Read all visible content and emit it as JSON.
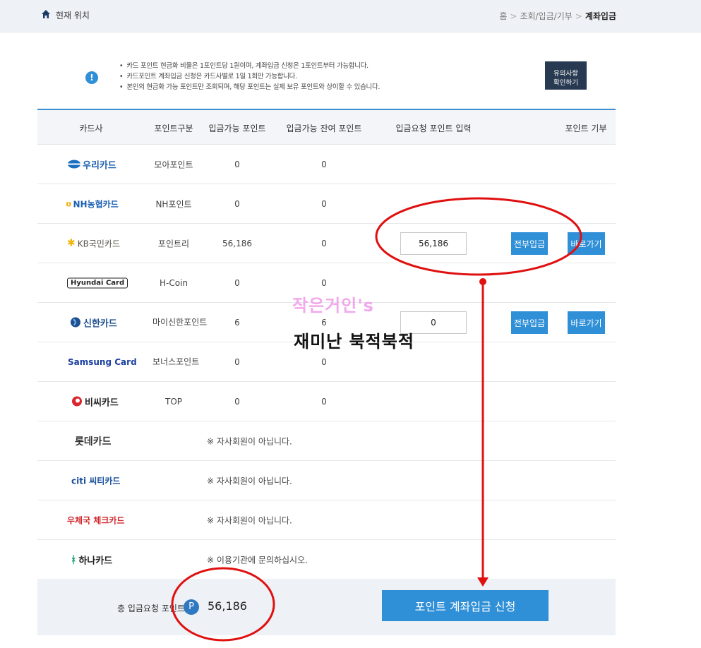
{
  "header": {
    "location_label": "현재 위치",
    "breadcrumb": [
      "홈",
      "조회/입금/기부",
      "계좌입금"
    ],
    "breadcrumb_sep": ">"
  },
  "notice": {
    "icon": "!",
    "lines": [
      "카드 포인트 현금화 비율은 1포인트당 1원이며, 계좌입금 신청은 1포인트부터 가능합니다.",
      "카드포인트 계좌입금 신청은 카드사별로 1일 1회만 가능합니다.",
      "본인의 현금화 가능 포인트만 조회되며, 해당 포인트는 실제 보유 포인트와 상이할 수 있습니다."
    ],
    "caution_button_line1": "유의사항",
    "caution_button_line2": "확인하기"
  },
  "table": {
    "headers": {
      "card": "카드사",
      "type": "포인트구분",
      "available": "입금가능 포인트",
      "remaining": "입금가능 잔여 포인트",
      "request": "입금요청 포인트 입력",
      "donate": "포인트 기부"
    },
    "rows": [
      {
        "card": "우리카드",
        "type": "모아포인트",
        "available": "0",
        "remaining": "0"
      },
      {
        "card": "NH농협카드",
        "type": "NH포인트",
        "available": "0",
        "remaining": "0"
      },
      {
        "card": "KB국민카드",
        "type": "포인트리",
        "available": "56,186",
        "remaining": "0",
        "input": "56,186",
        "all_label": "전부입금",
        "go_label": "바로가기"
      },
      {
        "card": "Hyundai Card",
        "type": "H-Coin",
        "available": "0",
        "remaining": "0"
      },
      {
        "card": "신한카드",
        "type": "마이신한포인트",
        "available": "6",
        "remaining": "6",
        "input": "0",
        "all_label": "전부입금",
        "go_label": "바로가기"
      },
      {
        "card": "Samsung Card",
        "type": "보너스포인트",
        "available": "0",
        "remaining": "0"
      },
      {
        "card": "비씨카드",
        "type": "TOP",
        "available": "0",
        "remaining": "0"
      },
      {
        "card": "롯데카드",
        "message": "※ 자사회원이 아닙니다."
      },
      {
        "card": "citi 씨티카드",
        "message": "※ 자사회원이 아닙니다."
      },
      {
        "card": "우체국 체크카드",
        "message": "※ 자사회원이 아닙니다."
      },
      {
        "card": "하나카드",
        "message": "※ 이용기관에 문의하십시오."
      }
    ]
  },
  "footer": {
    "total_label": "총 입금요청 포인트",
    "p_icon": "P",
    "total_value": "56,186",
    "apply_label": "포인트 계좌입금 신청"
  },
  "watermark": {
    "line1": "작은거인's",
    "line2": "재미난 북적북적"
  },
  "colors": {
    "accent": "#2f8fd7",
    "dark_button": "#283a51",
    "annotation_red": "#e01010",
    "header_bg": "#eef1f6"
  }
}
